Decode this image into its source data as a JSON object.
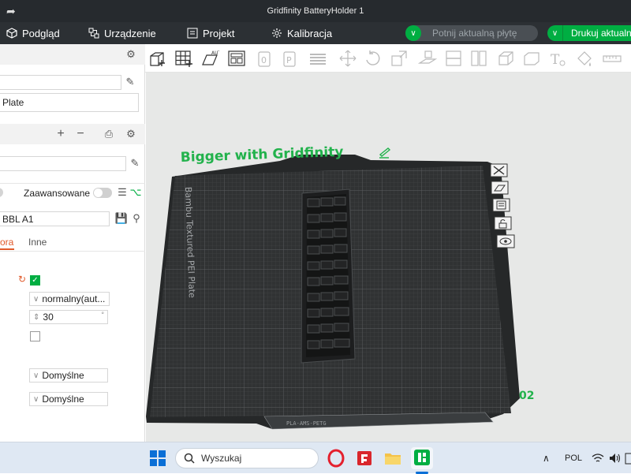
{
  "window": {
    "title": "Gridfinity BatteryHolder 1"
  },
  "menu": {
    "preview": "Podgląd",
    "device": "Urządzenie",
    "project": "Projekt",
    "calibration": "Kalibracja",
    "slice_button": "Potnij aktualną płytę",
    "print_button": "Drukuj aktualną"
  },
  "sidebar": {
    "plate_type": "Plate",
    "advanced_label": "Zaawansowane",
    "filament_preset": "BBL A1",
    "tabs": {
      "active": "ora",
      "other": "Inne"
    },
    "wall_generator": "normalny(aut...",
    "angle_value": "30",
    "angle_unit": "°",
    "dropdown_1": "Domyślne",
    "dropdown_2": "Domyślne"
  },
  "plate": {
    "title": "Bigger with Gridfinity",
    "side_label": "Bambu Textured PEI Plate",
    "plate_number": "02",
    "bottom_label": "PLA-AMS-PETG"
  },
  "taskbar": {
    "search_placeholder": "Wyszukaj",
    "language": "POL"
  },
  "colors": {
    "accent_green": "#00ae42",
    "title_green": "#22b24c",
    "dark_bar": "#2c3034",
    "bed_dark": "#2f3132"
  }
}
